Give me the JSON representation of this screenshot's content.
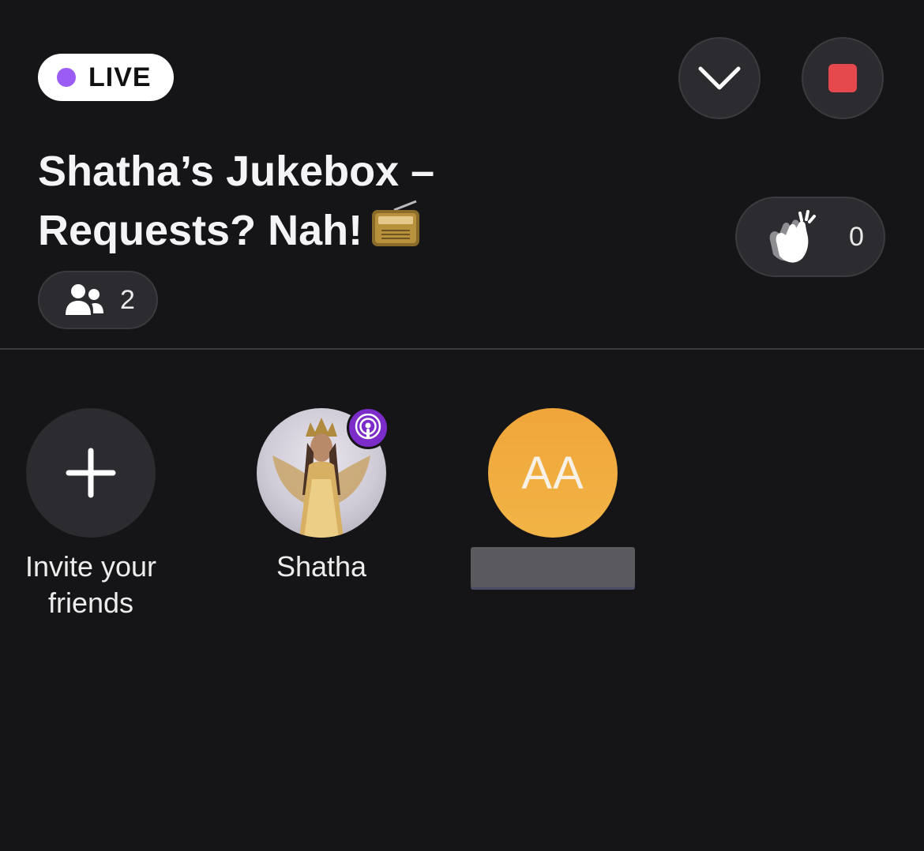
{
  "room": {
    "live_label": "LIVE",
    "title_line1": "Shatha’s Jukebox –",
    "title_line2": "Requests? Nah!",
    "listener_count": "2",
    "clap_count": "0"
  },
  "controls": {
    "collapse_icon": "chevron-down-icon",
    "stop_icon": "stop-icon"
  },
  "participants": [
    {
      "name": "Invite your friends",
      "line1": "Invite your",
      "line2": "friends",
      "icon": "plus-icon"
    },
    {
      "name": "Shatha",
      "badge_icon": "podcast-icon"
    },
    {
      "initials": "AA",
      "name_hidden": true
    }
  ],
  "colors": {
    "background": "#151517",
    "live_dot": "#9b5cf6",
    "stop": "#e5484d",
    "guest_avatar": "#f2ae40",
    "podcast_badge": "#7b2cc9"
  }
}
